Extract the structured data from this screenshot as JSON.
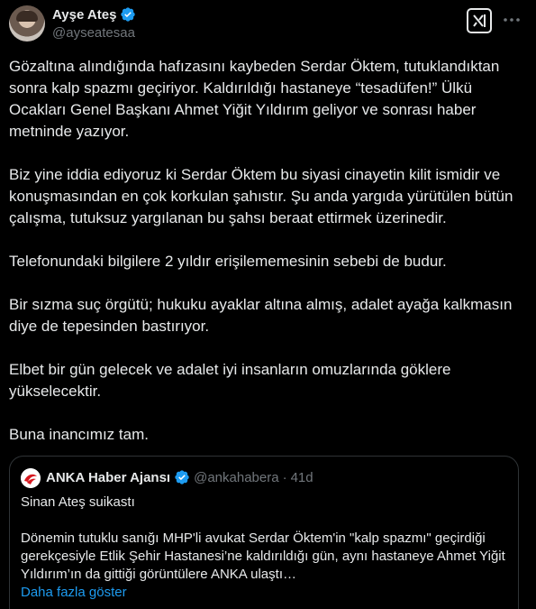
{
  "author": {
    "name": "Ayşe Ateş",
    "handle": "@ayseatesaa"
  },
  "tweet": {
    "paragraphs": [
      "Gözaltına alındığında hafızasını kaybeden Serdar Öktem, tutuklandıktan sonra kalp spazmı geçiriyor. Kaldırıldığı hastaneye “tesadüfen!” Ülkü Ocakları Genel Başkanı Ahmet Yiğit Yıldırım geliyor ve sonrası haber metninde yazıyor.",
      "Biz yine iddia ediyoruz ki Serdar Öktem bu siyasi cinayetin kilit ismidir ve konuşmasından en çok korkulan şahıstır. Şu anda yargıda yürütülen bütün çalışma, tutuksuz yargılanan bu şahsı beraat ettirmek üzerinedir.",
      "Telefonundaki bilgilere 2 yıldır erişilememesinin sebebi de budur.",
      "Bir sızma suç örgütü; hukuku ayaklar altına almış, adalet ayağa kalkmasın diye de tepesinden bastırıyor.",
      "Elbet bir gün gelecek ve adalet iyi insanların omuzlarında göklere yükselecektir.",
      "Buna inancımız tam."
    ]
  },
  "quote": {
    "name": "ANKA Haber Ajansı",
    "handle": "@ankahabera",
    "separator": "·",
    "time": "41d",
    "title": "Sinan Ateş suikastı",
    "text": "Dönemin tutuklu sanığı MHP'li avukat Serdar Öktem'in \"kalp spazmı\" geçirdiği gerekçesiyle Etlik Şehir Hastanesi’ne kaldırıldığı gün, aynı hastaneye Ahmet Yiğit Yıldırım’ın da gittiği görüntülere ANKA ulaştı…",
    "show_more": "Daha fazla göster"
  },
  "icons": {
    "verified": "verified-badge-icon",
    "grok": "grok-icon",
    "more": "more-options-icon"
  },
  "colors": {
    "background": "#000000",
    "text": "#e7e9ea",
    "muted": "#71767b",
    "link": "#1d9bf0",
    "verified": "#1d9bf0",
    "anka_red": "#d71920"
  }
}
